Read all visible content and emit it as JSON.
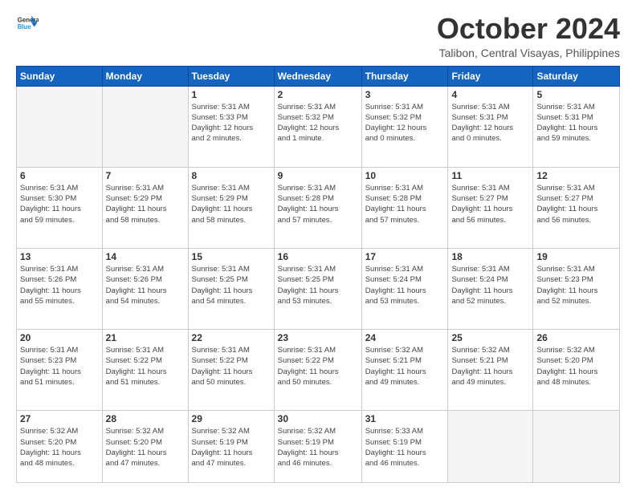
{
  "logo": {
    "line1": "General",
    "line2": "Blue"
  },
  "title": "October 2024",
  "location": "Talibon, Central Visayas, Philippines",
  "days_header": [
    "Sunday",
    "Monday",
    "Tuesday",
    "Wednesday",
    "Thursday",
    "Friday",
    "Saturday"
  ],
  "weeks": [
    [
      {
        "day": "",
        "info": ""
      },
      {
        "day": "",
        "info": ""
      },
      {
        "day": "1",
        "info": "Sunrise: 5:31 AM\nSunset: 5:33 PM\nDaylight: 12 hours\nand 2 minutes."
      },
      {
        "day": "2",
        "info": "Sunrise: 5:31 AM\nSunset: 5:32 PM\nDaylight: 12 hours\nand 1 minute."
      },
      {
        "day": "3",
        "info": "Sunrise: 5:31 AM\nSunset: 5:32 PM\nDaylight: 12 hours\nand 0 minutes."
      },
      {
        "day": "4",
        "info": "Sunrise: 5:31 AM\nSunset: 5:31 PM\nDaylight: 12 hours\nand 0 minutes."
      },
      {
        "day": "5",
        "info": "Sunrise: 5:31 AM\nSunset: 5:31 PM\nDaylight: 11 hours\nand 59 minutes."
      }
    ],
    [
      {
        "day": "6",
        "info": "Sunrise: 5:31 AM\nSunset: 5:30 PM\nDaylight: 11 hours\nand 59 minutes."
      },
      {
        "day": "7",
        "info": "Sunrise: 5:31 AM\nSunset: 5:29 PM\nDaylight: 11 hours\nand 58 minutes."
      },
      {
        "day": "8",
        "info": "Sunrise: 5:31 AM\nSunset: 5:29 PM\nDaylight: 11 hours\nand 58 minutes."
      },
      {
        "day": "9",
        "info": "Sunrise: 5:31 AM\nSunset: 5:28 PM\nDaylight: 11 hours\nand 57 minutes."
      },
      {
        "day": "10",
        "info": "Sunrise: 5:31 AM\nSunset: 5:28 PM\nDaylight: 11 hours\nand 57 minutes."
      },
      {
        "day": "11",
        "info": "Sunrise: 5:31 AM\nSunset: 5:27 PM\nDaylight: 11 hours\nand 56 minutes."
      },
      {
        "day": "12",
        "info": "Sunrise: 5:31 AM\nSunset: 5:27 PM\nDaylight: 11 hours\nand 56 minutes."
      }
    ],
    [
      {
        "day": "13",
        "info": "Sunrise: 5:31 AM\nSunset: 5:26 PM\nDaylight: 11 hours\nand 55 minutes."
      },
      {
        "day": "14",
        "info": "Sunrise: 5:31 AM\nSunset: 5:26 PM\nDaylight: 11 hours\nand 54 minutes."
      },
      {
        "day": "15",
        "info": "Sunrise: 5:31 AM\nSunset: 5:25 PM\nDaylight: 11 hours\nand 54 minutes."
      },
      {
        "day": "16",
        "info": "Sunrise: 5:31 AM\nSunset: 5:25 PM\nDaylight: 11 hours\nand 53 minutes."
      },
      {
        "day": "17",
        "info": "Sunrise: 5:31 AM\nSunset: 5:24 PM\nDaylight: 11 hours\nand 53 minutes."
      },
      {
        "day": "18",
        "info": "Sunrise: 5:31 AM\nSunset: 5:24 PM\nDaylight: 11 hours\nand 52 minutes."
      },
      {
        "day": "19",
        "info": "Sunrise: 5:31 AM\nSunset: 5:23 PM\nDaylight: 11 hours\nand 52 minutes."
      }
    ],
    [
      {
        "day": "20",
        "info": "Sunrise: 5:31 AM\nSunset: 5:23 PM\nDaylight: 11 hours\nand 51 minutes."
      },
      {
        "day": "21",
        "info": "Sunrise: 5:31 AM\nSunset: 5:22 PM\nDaylight: 11 hours\nand 51 minutes."
      },
      {
        "day": "22",
        "info": "Sunrise: 5:31 AM\nSunset: 5:22 PM\nDaylight: 11 hours\nand 50 minutes."
      },
      {
        "day": "23",
        "info": "Sunrise: 5:31 AM\nSunset: 5:22 PM\nDaylight: 11 hours\nand 50 minutes."
      },
      {
        "day": "24",
        "info": "Sunrise: 5:32 AM\nSunset: 5:21 PM\nDaylight: 11 hours\nand 49 minutes."
      },
      {
        "day": "25",
        "info": "Sunrise: 5:32 AM\nSunset: 5:21 PM\nDaylight: 11 hours\nand 49 minutes."
      },
      {
        "day": "26",
        "info": "Sunrise: 5:32 AM\nSunset: 5:20 PM\nDaylight: 11 hours\nand 48 minutes."
      }
    ],
    [
      {
        "day": "27",
        "info": "Sunrise: 5:32 AM\nSunset: 5:20 PM\nDaylight: 11 hours\nand 48 minutes."
      },
      {
        "day": "28",
        "info": "Sunrise: 5:32 AM\nSunset: 5:20 PM\nDaylight: 11 hours\nand 47 minutes."
      },
      {
        "day": "29",
        "info": "Sunrise: 5:32 AM\nSunset: 5:19 PM\nDaylight: 11 hours\nand 47 minutes."
      },
      {
        "day": "30",
        "info": "Sunrise: 5:32 AM\nSunset: 5:19 PM\nDaylight: 11 hours\nand 46 minutes."
      },
      {
        "day": "31",
        "info": "Sunrise: 5:33 AM\nSunset: 5:19 PM\nDaylight: 11 hours\nand 46 minutes."
      },
      {
        "day": "",
        "info": ""
      },
      {
        "day": "",
        "info": ""
      }
    ]
  ]
}
